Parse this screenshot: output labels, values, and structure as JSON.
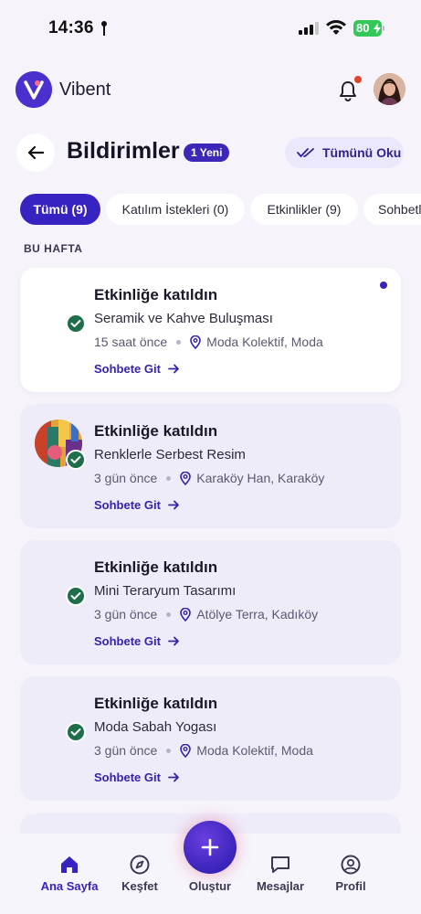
{
  "status_bar": {
    "time": "14:36",
    "battery": "80"
  },
  "header": {
    "app_name": "Vibent",
    "logo_letter": "V"
  },
  "page": {
    "title": "Bildirimler",
    "new_badge": "1 Yeni",
    "read_all_label": "Tümünü Oku"
  },
  "filters": [
    {
      "label": "Tümü (9)",
      "active": true
    },
    {
      "label": "Katılım İstekleri (0)",
      "active": false
    },
    {
      "label": "Etkinlikler (9)",
      "active": false
    },
    {
      "label": "Sohbetler",
      "active": false
    }
  ],
  "section_label": "BU HAFTA",
  "notifications": [
    {
      "title": "Etkinliğe katıldın",
      "event": "Seramik ve Kahve Buluşması",
      "time": "15 saat önce",
      "location": "Moda Kolektif, Moda",
      "link": "Sohbete Git",
      "unread": true
    },
    {
      "title": "Etkinliğe katıldın",
      "event": "Renklerle Serbest Resim",
      "time": "3 gün önce",
      "location": "Karaköy Han, Karaköy",
      "link": "Sohbete Git",
      "unread": false
    },
    {
      "title": "Etkinliğe katıldın",
      "event": "Mini Teraryum Tasarımı",
      "time": "3 gün önce",
      "location": "Atölye Terra, Kadıköy",
      "link": "Sohbete Git",
      "unread": false
    },
    {
      "title": "Etkinliğe katıldın",
      "event": "Moda Sabah Yogası",
      "time": "3 gün önce",
      "location": "Moda Kolektif, Moda",
      "link": "Sohbete Git",
      "unread": false
    }
  ],
  "tabbar": {
    "home": "Ana Sayfa",
    "explore": "Keşfet",
    "create": "Oluştur",
    "messages": "Mesajlar",
    "profile": "Profil"
  },
  "colors": {
    "accent": "#3722c2",
    "success": "#1e6e4a",
    "notification_dot": "#e0442c"
  }
}
